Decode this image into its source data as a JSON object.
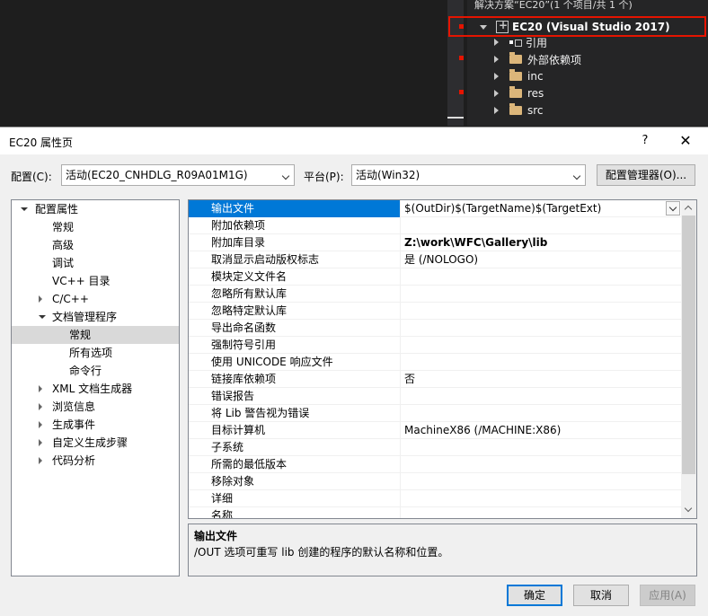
{
  "solution_explorer": {
    "solution_label": "解决方案“EC20”(1 个项目/共 1 个)",
    "project_label": "EC20 (Visual Studio 2017)",
    "items": [
      {
        "label": "引用"
      },
      {
        "label": "外部依赖项"
      },
      {
        "label": "inc"
      },
      {
        "label": "res"
      },
      {
        "label": "src"
      }
    ]
  },
  "dialog": {
    "title": "EC20 属性页",
    "help": "?",
    "close": "✕",
    "config_label": "配置(C):",
    "config_value": "活动(EC20_CNHDLG_R09A01M1G)",
    "platform_label": "平台(P):",
    "platform_value": "活动(Win32)",
    "config_manager": "配置管理器(O)..."
  },
  "left_tree": [
    {
      "label": "配置属性",
      "indent": 0,
      "exp": "down"
    },
    {
      "label": "常规",
      "indent": 1,
      "exp": ""
    },
    {
      "label": "高级",
      "indent": 1,
      "exp": ""
    },
    {
      "label": "调试",
      "indent": 1,
      "exp": ""
    },
    {
      "label": "VC++ 目录",
      "indent": 1,
      "exp": ""
    },
    {
      "label": "C/C++",
      "indent": 1,
      "exp": "right"
    },
    {
      "label": "文档管理程序",
      "indent": 1,
      "exp": "down"
    },
    {
      "label": "常规",
      "indent": 2,
      "exp": "",
      "selected": true
    },
    {
      "label": "所有选项",
      "indent": 2,
      "exp": ""
    },
    {
      "label": "命令行",
      "indent": 2,
      "exp": ""
    },
    {
      "label": "XML 文档生成器",
      "indent": 1,
      "exp": "right"
    },
    {
      "label": "浏览信息",
      "indent": 1,
      "exp": "right"
    },
    {
      "label": "生成事件",
      "indent": 1,
      "exp": "right"
    },
    {
      "label": "自定义生成步骤",
      "indent": 1,
      "exp": "right"
    },
    {
      "label": "代码分析",
      "indent": 1,
      "exp": "right"
    }
  ],
  "properties": [
    {
      "name": "输出文件",
      "value": "$(OutDir)$(TargetName)$(TargetExt)",
      "selected": true
    },
    {
      "name": "附加依赖项",
      "value": ""
    },
    {
      "name": "附加库目录",
      "value": "Z:\\work\\WFC\\Gallery\\lib",
      "bold": true
    },
    {
      "name": "取消显示启动版权标志",
      "value": "是 (/NOLOGO)"
    },
    {
      "name": "模块定义文件名",
      "value": ""
    },
    {
      "name": "忽略所有默认库",
      "value": ""
    },
    {
      "name": "忽略特定默认库",
      "value": ""
    },
    {
      "name": "导出命名函数",
      "value": ""
    },
    {
      "name": "强制符号引用",
      "value": ""
    },
    {
      "name": "使用 UNICODE 响应文件",
      "value": ""
    },
    {
      "name": "链接库依赖项",
      "value": "否"
    },
    {
      "name": "错误报告",
      "value": ""
    },
    {
      "name": "将 Lib 警告视为错误",
      "value": ""
    },
    {
      "name": "目标计算机",
      "value": "MachineX86 (/MACHINE:X86)"
    },
    {
      "name": "子系统",
      "value": ""
    },
    {
      "name": "所需的最低版本",
      "value": ""
    },
    {
      "name": "移除对象",
      "value": ""
    },
    {
      "name": "详细",
      "value": ""
    },
    {
      "name": "名称",
      "value": ""
    }
  ],
  "description": {
    "title": "输出文件",
    "text": "/OUT 选项可重写 lib 创建的程序的默认名称和位置。"
  },
  "buttons": {
    "ok": "确定",
    "cancel": "取消",
    "apply": "应用(A)"
  }
}
